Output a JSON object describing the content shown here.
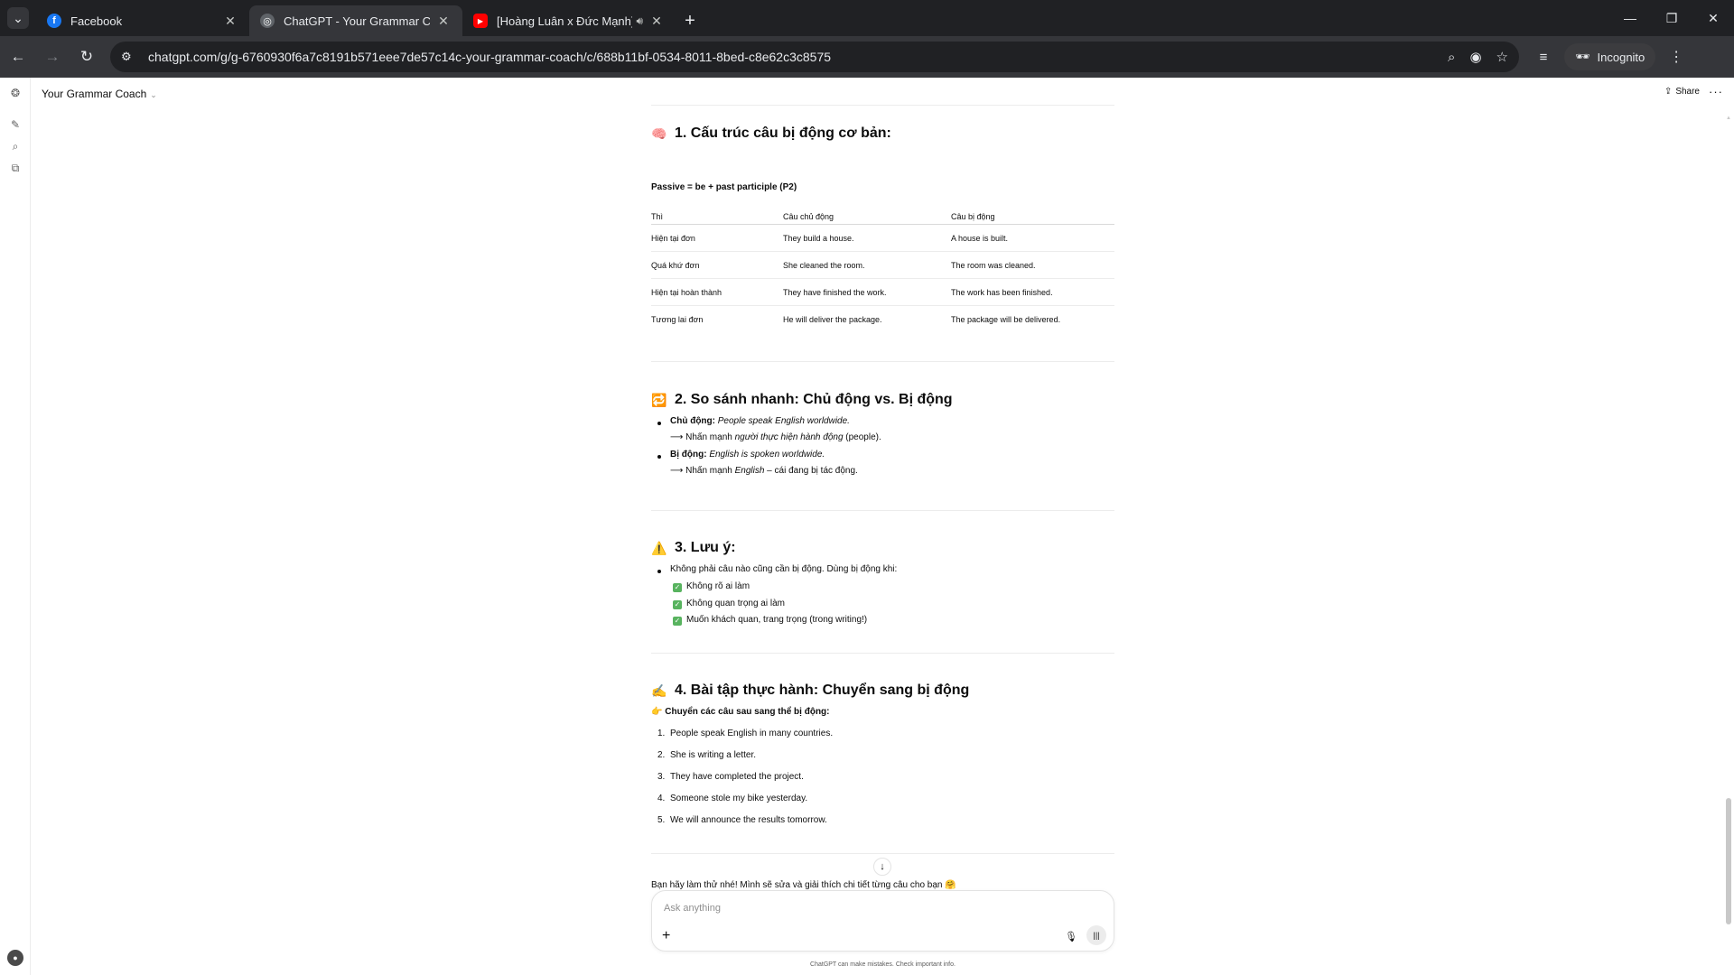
{
  "browser": {
    "tabs": [
      {
        "title": "Facebook",
        "icon": "facebook-icon",
        "active": false
      },
      {
        "title": "ChatGPT - Your Grammar Coach",
        "icon": "chatgpt-icon",
        "active": true
      },
      {
        "title": "[Hoàng Luân x Đức Mạnh] Bạn",
        "icon": "youtube-icon",
        "active": false
      }
    ],
    "url": "chatgpt.com/g/g-6760930f6a7c8191b571eee7de57c14c-your-grammar-coach/c/688b11bf-0534-8011-8bed-c8e62c3c8575",
    "profile_label": "Incognito"
  },
  "app": {
    "gpt_name": "Your Grammar Coach",
    "share_label": "Share",
    "composer_placeholder": "Ask anything",
    "disclaimer": "ChatGPT can make mistakes. Check important info."
  },
  "content": {
    "section1": {
      "emoji": "🧠",
      "heading": "1. Cấu trúc câu bị động cơ bản:",
      "formula": "Passive = be + past participle (P2)",
      "table": {
        "headers": [
          "Thì",
          "Câu chủ động",
          "Câu bị động"
        ],
        "rows": [
          [
            "Hiện tại đơn",
            "They build a house.",
            "A house is built."
          ],
          [
            "Quá khứ đơn",
            "She cleaned the room.",
            "The room was cleaned."
          ],
          [
            "Hiện tại hoàn thành",
            "They have finished the work.",
            "The work has been finished."
          ],
          [
            "Tương lai đơn",
            "He will deliver the package.",
            "The package will be delivered."
          ]
        ]
      }
    },
    "section2": {
      "emoji": "🔁",
      "heading": "2. So sánh nhanh: Chủ động vs. Bị động",
      "items": [
        {
          "label": "Chủ động:",
          "example": "People speak English worldwide.",
          "arrow": "⟶ Nhấn mạnh ",
          "emph": "người thực hiện hành động",
          "tail": " (people)."
        },
        {
          "label": "Bị động:",
          "example": "English is spoken worldwide.",
          "arrow": "⟶ Nhấn mạnh ",
          "emph": "English",
          "tail": " – cái đang bị tác động."
        }
      ]
    },
    "section3": {
      "emoji": "⚠️",
      "heading": "3. Lưu ý:",
      "intro": "Không phải câu nào cũng cần bị động. Dùng bị động khi:",
      "checks": [
        "Không rõ ai làm",
        "Không quan trọng ai làm",
        "Muốn khách quan, trang trọng (trong writing!)"
      ]
    },
    "section4": {
      "emoji": "✍️",
      "heading": "4. Bài tập thực hành: Chuyển sang bị động",
      "pointer": "👉",
      "instruction": "Chuyển các câu sau sang thể bị động:",
      "exercises": [
        "People speak English in many countries.",
        "She is writing a letter.",
        "They have completed the project.",
        "Someone stole my bike yesterday.",
        "We will announce the results tomorrow."
      ],
      "closing": "Bạn hãy làm thử nhé! Mình sẽ sửa và giải thích chi tiết từng câu cho bạn 🤗"
    }
  }
}
